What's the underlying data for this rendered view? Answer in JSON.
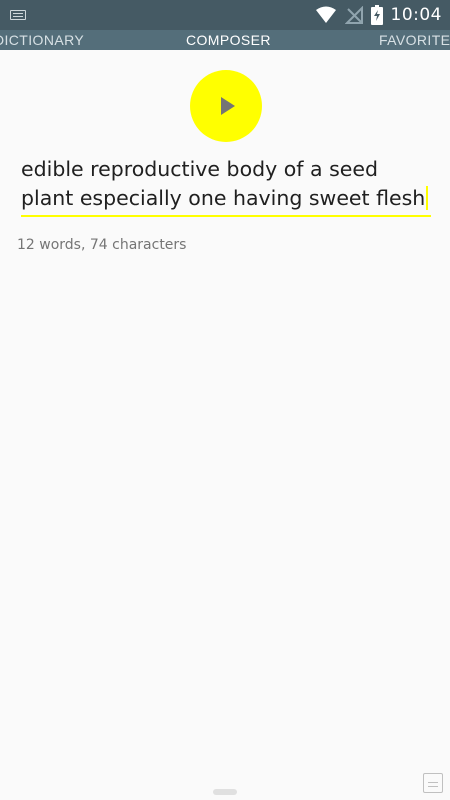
{
  "status_bar": {
    "time": "10:04",
    "icons": [
      "keyboard-icon",
      "wifi-icon",
      "no-signal-icon",
      "battery-charging-icon"
    ]
  },
  "tabs": [
    {
      "label": "DICTIONARY"
    },
    {
      "label": "COMPOSER"
    },
    {
      "label": "FAVORITES"
    }
  ],
  "composer": {
    "text": "edible reproductive body of a seed plant especially one having sweet flesh",
    "count_label": "12 words, 74 characters"
  },
  "colors": {
    "status_bar": "#455a64",
    "tab_bar": "#546e7a",
    "accent": "#ffff00"
  }
}
